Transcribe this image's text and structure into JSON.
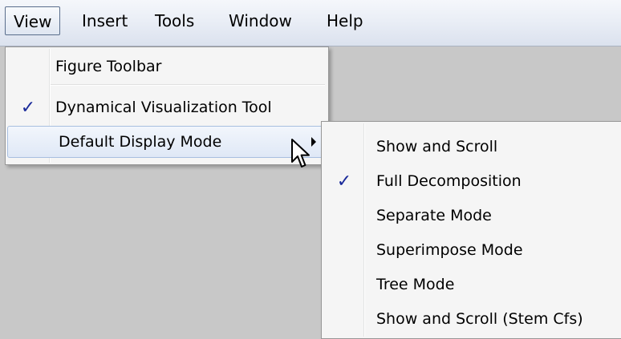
{
  "menubar": {
    "items": [
      {
        "label": "View",
        "active": true
      },
      {
        "label": "Insert",
        "active": false
      },
      {
        "label": "Tools",
        "active": false
      },
      {
        "label": "Window",
        "active": false
      },
      {
        "label": "Help",
        "active": false
      }
    ]
  },
  "view_menu": {
    "items": [
      {
        "label": "Figure Toolbar",
        "checked": false
      },
      {
        "label": "Dynamical Visualization Tool",
        "checked": true
      },
      {
        "label": "Default Display Mode",
        "checked": false,
        "has_submenu": true,
        "highlighted": true
      }
    ]
  },
  "submenu": {
    "items": [
      {
        "label": "Show and Scroll",
        "checked": false
      },
      {
        "label": "Full Decomposition",
        "checked": true
      },
      {
        "label": "Separate Mode",
        "checked": false
      },
      {
        "label": "Superimpose Mode",
        "checked": false
      },
      {
        "label": "Tree Mode",
        "checked": false
      },
      {
        "label": "Show and Scroll (Stem Cfs)",
        "checked": false
      }
    ]
  },
  "icons": {
    "checkmark": "✓",
    "submenu_arrow": "chevron-right-icon",
    "cursor": "arrow-cursor-icon"
  },
  "colors": {
    "check": "#1a2a9a",
    "highlight_border": "#a8bfe0",
    "workspace_bg": "#c8c8c8"
  }
}
